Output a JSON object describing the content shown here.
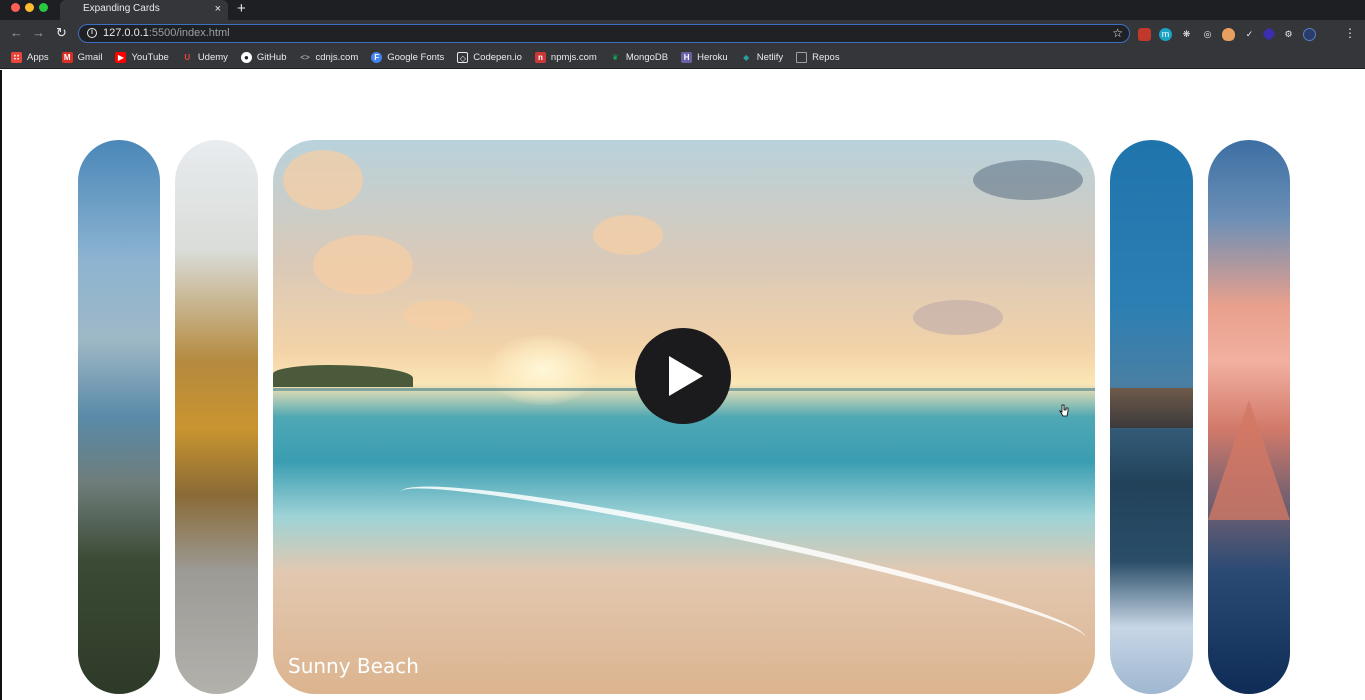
{
  "browser": {
    "tab_title": "Expanding Cards",
    "tab_close": "×",
    "new_tab": "+",
    "url_host": "127.0.0.1",
    "url_rest": ":5500/index.html",
    "bookmarks": [
      {
        "label": "Apps",
        "icon": "apps-grid-icon",
        "color": "#e8453c"
      },
      {
        "label": "Gmail",
        "icon": "gmail-icon",
        "color": "#d93025"
      },
      {
        "label": "YouTube",
        "icon": "youtube-icon",
        "color": "#ff0000"
      },
      {
        "label": "Udemy",
        "icon": "udemy-icon",
        "color": "#a435f0"
      },
      {
        "label": "GitHub",
        "icon": "github-icon",
        "color": "#ffffff"
      },
      {
        "label": "cdnjs.com",
        "icon": "code-icon",
        "color": "#9aa0a6"
      },
      {
        "label": "Google Fonts",
        "icon": "google-fonts-icon",
        "color": "#4285f4"
      },
      {
        "label": "Codepen.io",
        "icon": "codepen-icon",
        "color": "#ffffff"
      },
      {
        "label": "npmjs.com",
        "icon": "npm-icon",
        "color": "#cb3837"
      },
      {
        "label": "MongoDB",
        "icon": "mongodb-leaf-icon",
        "color": "#13aa52"
      },
      {
        "label": "Heroku",
        "icon": "heroku-icon",
        "color": "#6762a6"
      },
      {
        "label": "Netlify",
        "icon": "netlify-icon",
        "color": "#25a2a0"
      },
      {
        "label": "Repos",
        "icon": "folder-icon",
        "color": "#9aa0a6"
      }
    ]
  },
  "cards": {
    "active_title": "Sunny Beach"
  },
  "colors": {
    "play_button": "#1b1b1d",
    "page_background": "#ffffff"
  }
}
